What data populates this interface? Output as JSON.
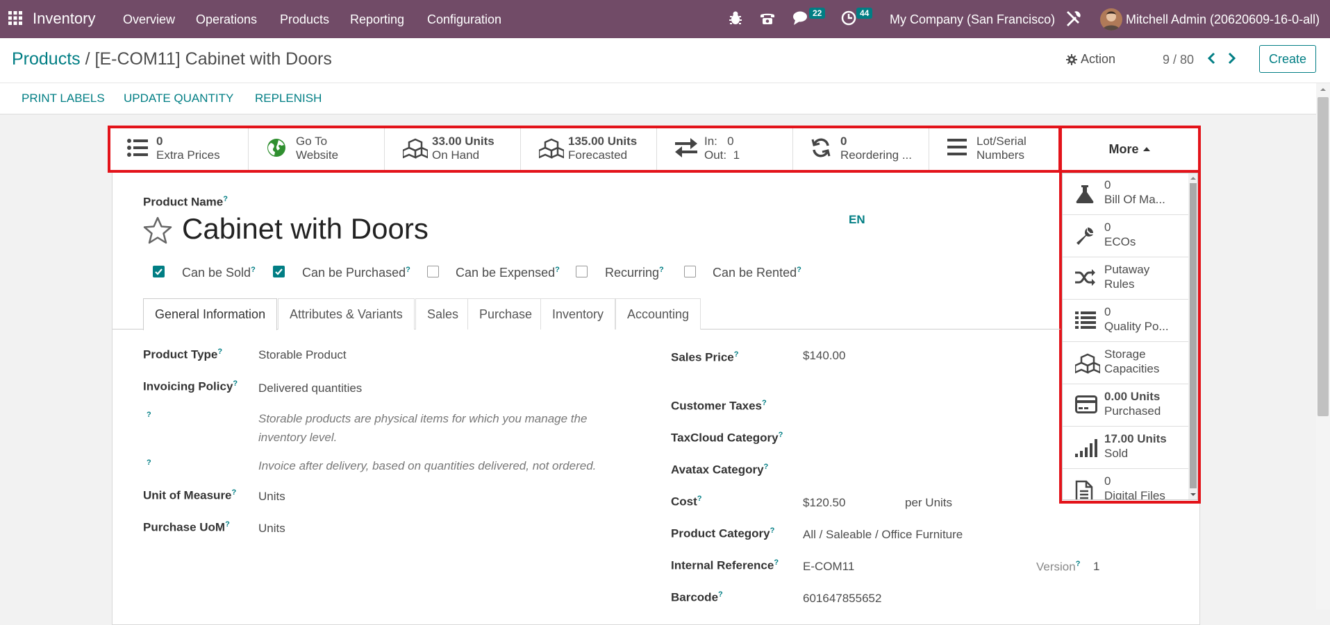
{
  "navbar": {
    "app_name": "Inventory",
    "menus": [
      "Overview",
      "Operations",
      "Products",
      "Reporting",
      "Configuration"
    ],
    "messages_count": "22",
    "activities_count": "44",
    "company": "My Company (San Francisco)",
    "user": "Mitchell Admin (20620609-16-0-all)"
  },
  "control": {
    "breadcrumb_root": "Products",
    "breadcrumb_sep": "/",
    "breadcrumb_current": "[E-COM11] Cabinet with Doors",
    "action_label": "Action",
    "pager": "9 / 80",
    "create_label": "Create",
    "status_buttons": [
      "PRINT LABELS",
      "UPDATE QUANTITY",
      "REPLENISH"
    ]
  },
  "smart_buttons": [
    {
      "icon": "list-icon",
      "value": "0",
      "label": "Extra Prices"
    },
    {
      "icon": "globe-icon",
      "value": "Go To",
      "label": "Website"
    },
    {
      "icon": "cubes-icon",
      "value": "33.00 Units",
      "label": "On Hand"
    },
    {
      "icon": "cubes-icon",
      "value": "135.00 Units",
      "label": "Forecasted"
    },
    {
      "icon": "exchange-icon",
      "value": "In:   0",
      "label": "Out:  1"
    },
    {
      "icon": "refresh-icon",
      "value": "0",
      "label": "Reordering ..."
    },
    {
      "icon": "bars-icon",
      "value": "Lot/Serial",
      "label": "Numbers"
    }
  ],
  "more": {
    "label": "More",
    "items": [
      {
        "icon": "flask-icon",
        "value": "0",
        "label": "Bill Of Ma..."
      },
      {
        "icon": "wrench-icon",
        "value": "0",
        "label": "ECOs"
      },
      {
        "icon": "random-icon",
        "value": "Putaway",
        "label": "Rules"
      },
      {
        "icon": "list-icon",
        "value": "0",
        "label": "Quality Po..."
      },
      {
        "icon": "cubes-icon",
        "value": "Storage",
        "label": "Capacities"
      },
      {
        "icon": "credit-card-icon",
        "value": "0.00 Units",
        "label": "Purchased"
      },
      {
        "icon": "signal-icon",
        "value": "17.00 Units",
        "label": "Sold"
      },
      {
        "icon": "file-icon",
        "value": "0",
        "label": "Digital Files"
      }
    ]
  },
  "form": {
    "product_name_label": "Product Name",
    "product_name": "Cabinet with Doors",
    "lang": "EN",
    "checkboxes": [
      {
        "label": "Can be Sold",
        "checked": true
      },
      {
        "label": "Can be Purchased",
        "checked": true
      },
      {
        "label": "Can be Expensed",
        "checked": false
      },
      {
        "label": "Recurring",
        "checked": false
      },
      {
        "label": "Can be Rented",
        "checked": false
      }
    ],
    "tabs": [
      "General Information",
      "Attributes & Variants",
      "Sales",
      "Purchase",
      "Inventory",
      "Accounting"
    ],
    "left": {
      "product_type_label": "Product Type",
      "product_type": "Storable Product",
      "invoicing_policy_label": "Invoicing Policy",
      "invoicing_policy": "Delivered quantities",
      "help1": "Storable products are physical items for which you manage the inventory level.",
      "help2": "Invoice after delivery, based on quantities delivered, not ordered.",
      "uom_label": "Unit of Measure",
      "uom": "Units",
      "purchase_uom_label": "Purchase UoM",
      "purchase_uom": "Units"
    },
    "right": {
      "sales_price_label": "Sales Price",
      "sales_price": "$140.00",
      "customer_taxes_label": "Customer Taxes",
      "taxcloud_label": "TaxCloud Category",
      "avatax_label": "Avatax Category",
      "cost_label": "Cost",
      "cost": "$120.50",
      "cost_unit": "per Units",
      "category_label": "Product Category",
      "category": "All / Saleable / Office Furniture",
      "internal_ref_label": "Internal Reference",
      "internal_ref": "E-COM11",
      "version_label": "Version",
      "version": "1",
      "barcode_label": "Barcode",
      "barcode": "601647855652"
    }
  },
  "colors": {
    "navbar": "#714b67",
    "accent": "#017e84",
    "highlight": "#e3131a"
  }
}
